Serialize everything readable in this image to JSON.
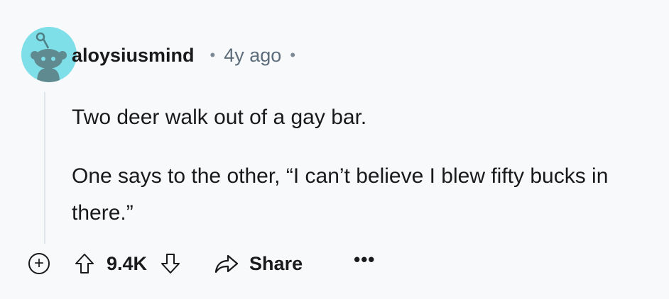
{
  "comment": {
    "username": "aloysiusmind",
    "separator": "•",
    "timestamp": "4y ago",
    "trailing_separator": "•",
    "body": [
      "Two deer walk out of a gay bar.",
      "One says to the other, “I can’t believe I blew fifty bucks in there.”"
    ],
    "avatar_color": "#7fdfe9"
  },
  "actions": {
    "expand_symbol": "+",
    "upvote_icon": "arrow-up-outline-icon",
    "score": "9.4K",
    "downvote_icon": "arrow-down-outline-icon",
    "share_icon": "share-arrow-icon",
    "share_label": "Share",
    "more_label": "•••"
  }
}
